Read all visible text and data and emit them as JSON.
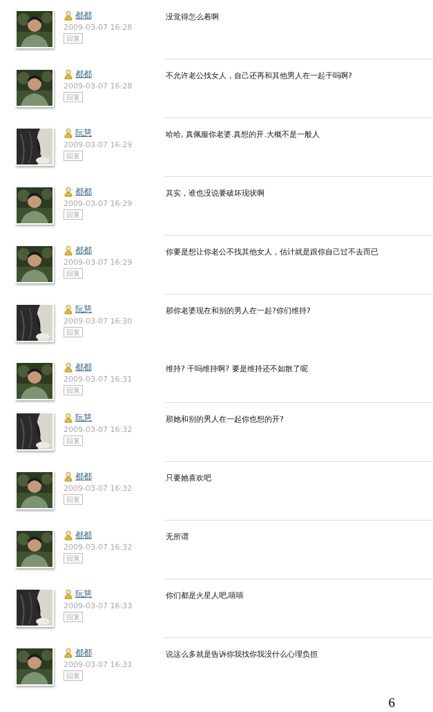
{
  "comments": [
    {
      "author": "都都",
      "time": "2009-03-07 16:28",
      "reply": "回复",
      "text": "没觉得怎么着啊",
      "divider": false
    },
    {
      "author": "都都",
      "time": "2009-03-07 16:28",
      "reply": "回复",
      "text": "不允许老公找女人，自己还再和其他男人在一起干吗啊?",
      "divider": true
    },
    {
      "author": "阮慧",
      "time": "2009-03-07 16:29",
      "reply": "回复",
      "text": "哈哈, 真佩服你老婆.真想的开.大概不是一般人",
      "divider": true
    },
    {
      "author": "都都",
      "time": "2009-03-07 16:29",
      "reply": "回复",
      "text": "其实，谁也没说要破坏现状啊",
      "divider": true
    },
    {
      "author": "都都",
      "time": "2009-03-07 16:29",
      "reply": "回复",
      "text": "你要是想让你老公不找其他女人，估计就是跟你自己过不去而已",
      "divider": true
    },
    {
      "author": "阮慧",
      "time": "2009-03-07 16:30",
      "reply": "回复",
      "text": "那你老婆现在和别的男人在一起?你们维持?",
      "divider": true
    },
    {
      "author": "都都",
      "time": "2009-03-07 16:31",
      "reply": "回复",
      "text": "维持? 干吗维持啊? 要是维持还不如散了呢",
      "divider": false
    },
    {
      "author": "阮慧",
      "time": "2009-03-07 16:32",
      "reply": "回复",
      "text": "那她和别的男人在一起你也想的开?",
      "divider": true
    },
    {
      "author": "都都",
      "time": "2009-03-07 16:32",
      "reply": "回复",
      "text": "只要她喜欢吧",
      "divider": true
    },
    {
      "author": "都都",
      "time": "2009-03-07 16:32",
      "reply": "回复",
      "text": "无所谓",
      "divider": true
    },
    {
      "author": "阮慧",
      "time": "2009-03-07 16:33",
      "reply": "回复",
      "text": "你们都是火星人吧,嘻嘻",
      "divider": true
    },
    {
      "author": "都都",
      "time": "2009-03-07 16:33",
      "reply": "回复",
      "text": "说这么多就是告诉你我找你我没什么心理负担",
      "divider": true
    }
  ],
  "page_number": "6"
}
